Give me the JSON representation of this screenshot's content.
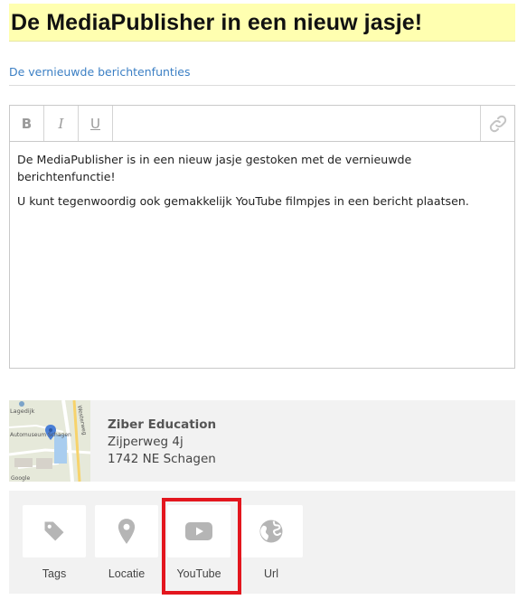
{
  "page": {
    "title": "De MediaPublisher in een nieuw jasje!",
    "subtitle": "De vernieuwde berichtenfunties"
  },
  "toolbar": {
    "bold_label": "B",
    "italic_label": "I",
    "underline_label": "U",
    "link_icon": "link-icon"
  },
  "editor": {
    "paragraphs": [
      "De MediaPublisher is in een nieuw jasje gestoken met de vernieuwde berichtenfunctie!",
      "U kunt tegenwoordig ook gemakkelijk YouTube filmpjes in een bericht plaatsen."
    ]
  },
  "location": {
    "name": "Ziber Education",
    "street": "Zijperweg 4j",
    "city": "1742 NE Schagen",
    "map_labels": {
      "place": "Lagedijk",
      "poi": "Automuseum Schagen",
      "road": "Westerweg",
      "credit": "Google"
    }
  },
  "attachments": [
    {
      "label": "Tags",
      "icon": "tag-icon"
    },
    {
      "label": "Locatie",
      "icon": "location-pin-icon"
    },
    {
      "label": "YouTube",
      "icon": "youtube-icon",
      "highlighted": true
    },
    {
      "label": "Url",
      "icon": "globe-icon"
    }
  ],
  "colors": {
    "title_background": "#ffffb0",
    "link_blue": "#3b7fc4",
    "panel_grey": "#f2f2f2",
    "icon_grey": "#b5b5b5",
    "highlight_red": "#e3161e"
  }
}
